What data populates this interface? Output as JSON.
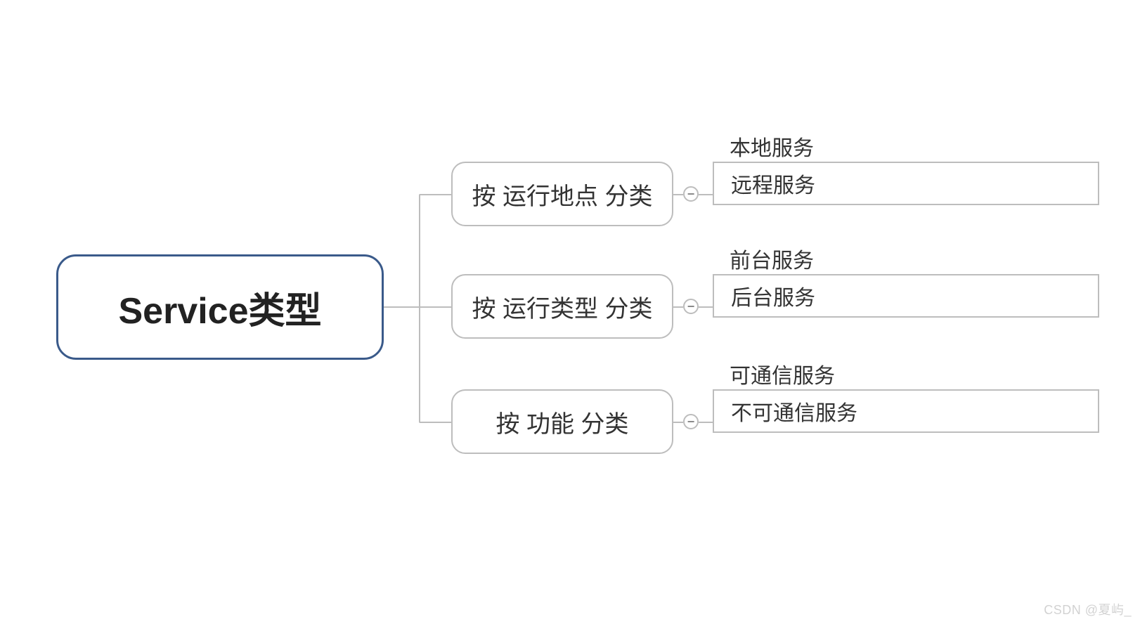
{
  "root": {
    "label": "Service类型"
  },
  "branches": [
    {
      "label": "按 运行地点 分类",
      "leaves_top": "本地服务",
      "leaves_bottom": "远程服务"
    },
    {
      "label": "按 运行类型 分类",
      "leaves_top": "前台服务",
      "leaves_bottom": "后台服务"
    },
    {
      "label": "按 功能 分类",
      "leaves_top": "可通信服务",
      "leaves_bottom": "不可通信服务"
    }
  ],
  "collapse_symbol": "−",
  "watermark": "CSDN @夏屿_"
}
